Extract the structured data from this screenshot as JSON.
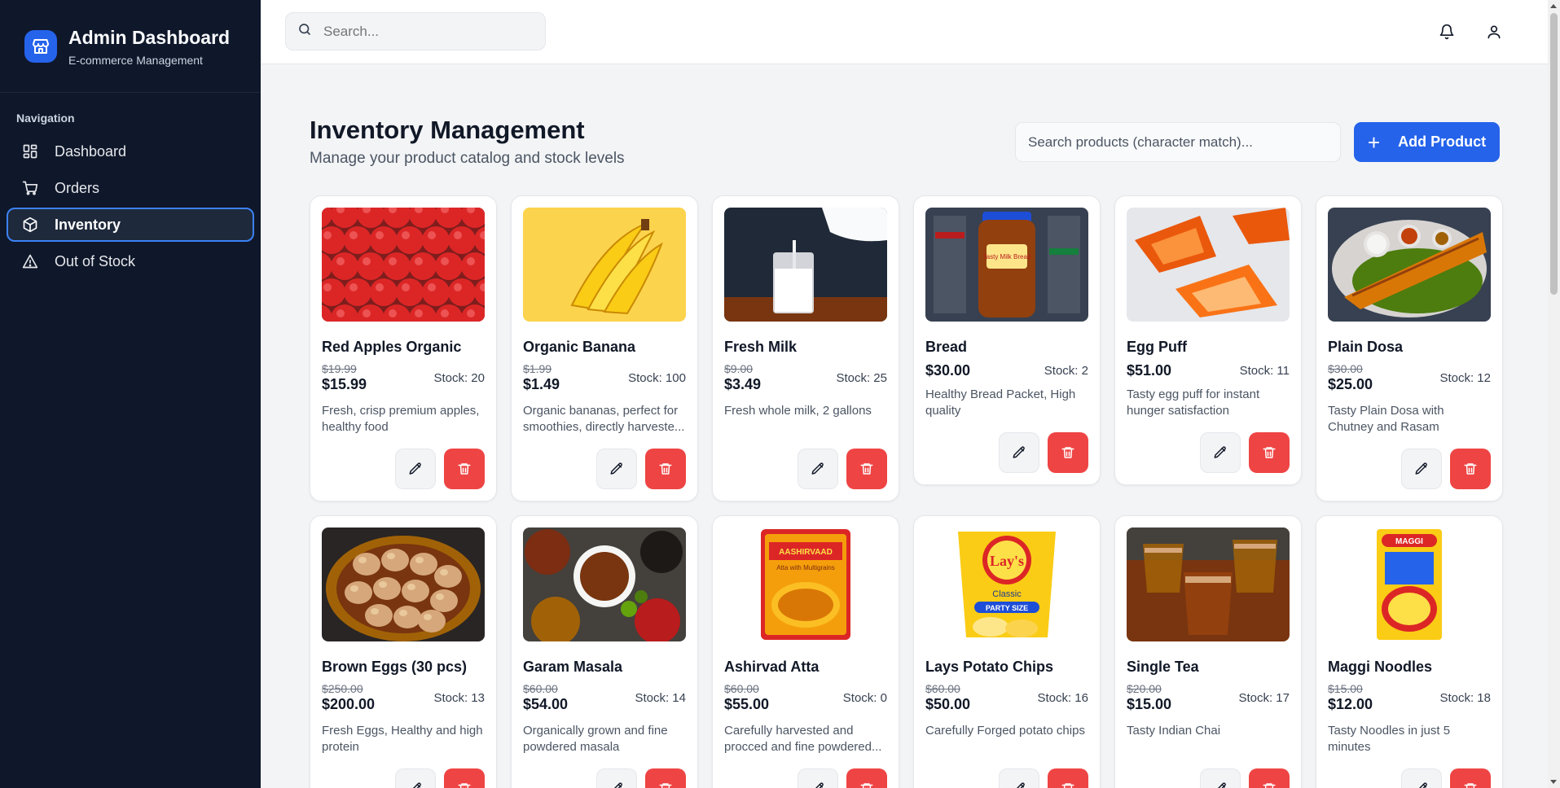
{
  "sidebar": {
    "title": "Admin Dashboard",
    "subtitle": "E-commerce Management",
    "nav_heading": "Navigation",
    "items": [
      {
        "label": "Dashboard",
        "icon": "dashboard-grid-icon"
      },
      {
        "label": "Orders",
        "icon": "cart-icon"
      },
      {
        "label": "Inventory",
        "icon": "package-icon",
        "active": true
      },
      {
        "label": "Out of Stock",
        "icon": "warning-icon"
      }
    ]
  },
  "topbar": {
    "search_placeholder": "Search...",
    "icons": [
      "bell-icon",
      "user-icon"
    ]
  },
  "page": {
    "title": "Inventory Management",
    "subtitle": "Manage your product catalog and stock levels",
    "search_placeholder": "Search products (character match)...",
    "add_button_label": "Add Product",
    "add_button_icon": "+"
  },
  "products": [
    {
      "name": "Red Apples Organic",
      "old_price": "$19.99",
      "price": "$15.99",
      "stock": "Stock: 20",
      "description": "Fresh, crisp premium apples, healthy food"
    },
    {
      "name": "Organic Banana",
      "old_price": "$1.99",
      "price": "$1.49",
      "stock": "Stock: 100",
      "description": "Organic bananas, perfect for smoothies, directly harveste..."
    },
    {
      "name": "Fresh Milk",
      "old_price": "$9.00",
      "price": "$3.49",
      "stock": "Stock: 25",
      "description": "Fresh whole milk, 2 gallons"
    },
    {
      "name": "Bread",
      "old_price": "",
      "price": "$30.00",
      "stock": "Stock: 2",
      "description": "Healthy Bread Packet, High quality"
    },
    {
      "name": "Egg Puff",
      "old_price": "",
      "price": "$51.00",
      "stock": "Stock: 11",
      "description": "Tasty egg puff for instant hunger satisfaction"
    },
    {
      "name": "Plain Dosa",
      "old_price": "$30.00",
      "price": "$25.00",
      "stock": "Stock: 12",
      "description": "Tasty Plain Dosa with Chutney and Rasam"
    },
    {
      "name": "Brown Eggs (30 pcs)",
      "old_price": "$250.00",
      "price": "$200.00",
      "stock": "Stock: 13",
      "description": "Fresh Eggs, Healthy and high protein"
    },
    {
      "name": "Garam Masala",
      "old_price": "$60.00",
      "price": "$54.00",
      "stock": "Stock: 14",
      "description": "Organically grown and fine powdered masala"
    },
    {
      "name": "Ashirvad Atta",
      "old_price": "$60.00",
      "price": "$55.00",
      "stock": "Stock: 0",
      "description": "Carefully harvested and procced and fine powdered..."
    },
    {
      "name": "Lays Potato Chips",
      "old_price": "$60.00",
      "price": "$50.00",
      "stock": "Stock: 16",
      "description": "Carefully Forged potato chips"
    },
    {
      "name": "Single Tea",
      "old_price": "$20.00",
      "price": "$15.00",
      "stock": "Stock: 17",
      "description": "Tasty Indian Chai"
    },
    {
      "name": "Maggi Noodles",
      "old_price": "$15.00",
      "price": "$12.00",
      "stock": "Stock: 18",
      "description": "Tasty Noodles in just 5 minutes"
    }
  ],
  "image_text": {
    "atta_brand": "AASHIRVAAD",
    "atta_sub": "Atta with Multigrains",
    "lays_brand": "Lay's",
    "lays_flavor": "Classic",
    "lays_size": "PARTY SIZE",
    "maggi_brand": "MAGGI",
    "bread_label": "Tasty Milk Bread"
  },
  "colors": {
    "sidebar_bg": "#0f172a",
    "accent": "#2563eb",
    "danger": "#ef4444"
  }
}
